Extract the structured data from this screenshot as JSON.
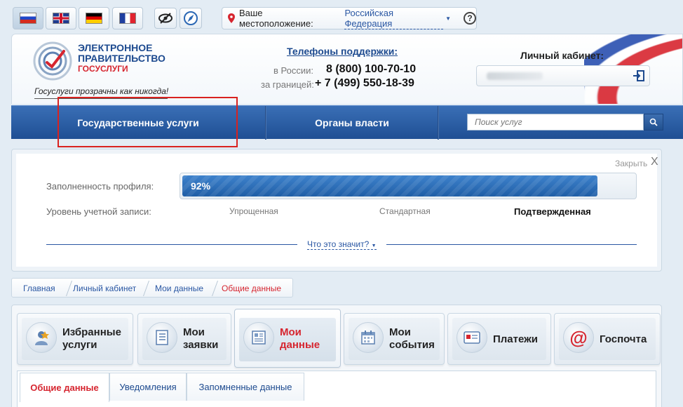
{
  "languages": [
    {
      "code": "ru",
      "active": true
    },
    {
      "code": "en",
      "active": false
    },
    {
      "code": "de",
      "active": false
    },
    {
      "code": "fr",
      "active": false
    }
  ],
  "location": {
    "label": "Ваше местоположение:",
    "value": "Российская Федерация",
    "help": "?"
  },
  "logo": {
    "line1": "ЭЛЕКТРОННОЕ",
    "line2": "ПРАВИТЕЛЬСТВО",
    "line3": "ГОСУСЛУГИ",
    "slogan": "Госуслуги прозрачны как никогда!"
  },
  "support": {
    "title": "Телефоны поддержки",
    "colon": ":",
    "russia_label": "в России:",
    "russia_phone": "8 (800) 100-70-10",
    "abroad_label": "за границей:",
    "abroad_phone": "+ 7 (499) 550-18-39"
  },
  "cabinet": {
    "title": "Личный кабинет:"
  },
  "nav": {
    "services": "Государственные услуги",
    "authorities": "Органы власти",
    "search_placeholder": "Поиск услуг"
  },
  "profile": {
    "close": "Закрыть",
    "close_x": "X",
    "fill_label": "Заполненность профиля:",
    "fill_value": "92%",
    "fill_fraction": 0.92,
    "level_label": "Уровень учетной записи:",
    "levels": [
      "Упрощенная",
      "Стандартная",
      "Подтвержденная"
    ],
    "meaning_link": "Что это значит?"
  },
  "breadcrumb": [
    "Главная",
    "Личный кабинет",
    "Мои данные",
    "Общие данные"
  ],
  "services": [
    {
      "line1": "Избранные",
      "line2": "услуги",
      "icon": "favorite-services-icon"
    },
    {
      "line1": "Мои",
      "line2": "заявки",
      "icon": "requests-list-icon"
    },
    {
      "line1": "Мои",
      "line2": "данные",
      "icon": "my-data-icon",
      "active": true
    },
    {
      "line1": "Мои",
      "line2": "события",
      "icon": "calendar-icon"
    },
    {
      "line1": "Платежи",
      "line2": "",
      "icon": "payments-icon"
    },
    {
      "line1": "Госпочта",
      "line2": "",
      "icon": "mail-at-icon"
    }
  ],
  "tabs": [
    "Общие данные",
    "Уведомления",
    "Запомненные данные"
  ],
  "colors": {
    "brand_blue": "#1d4a8f",
    "accent_red": "#d6252f",
    "nav_blue": "#2a5da3"
  }
}
